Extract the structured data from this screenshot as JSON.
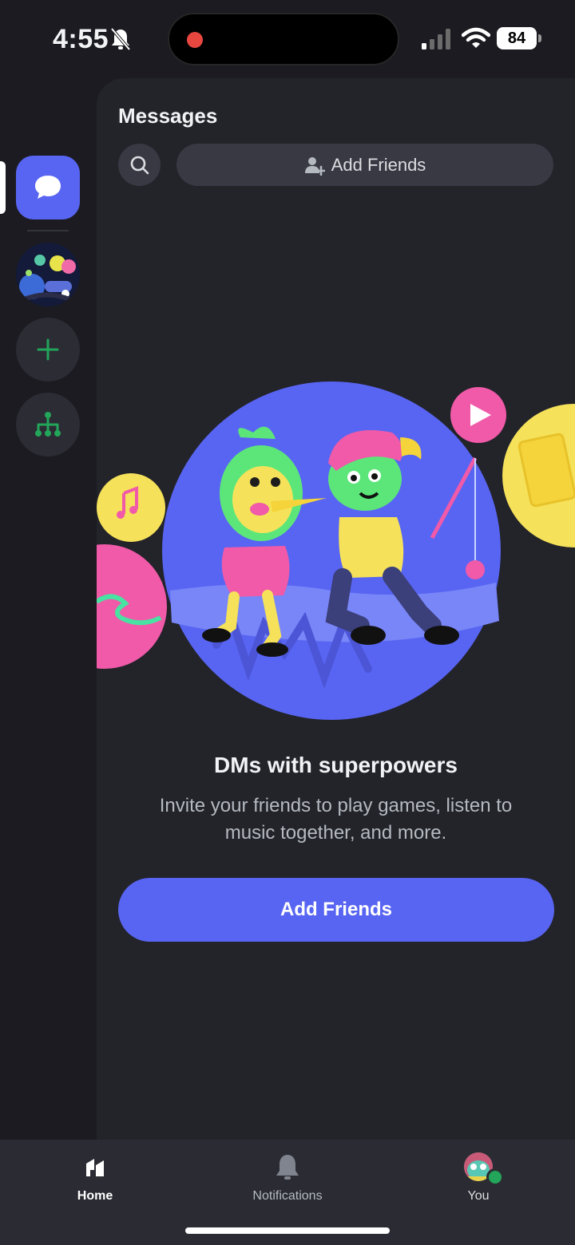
{
  "status_bar": {
    "time": "4:55",
    "battery": "84",
    "icons": [
      "bell-muted-icon",
      "recording-dot-icon",
      "cellular-signal-icon",
      "wifi-icon",
      "battery-icon"
    ]
  },
  "rail": {
    "items": [
      {
        "name": "direct-messages",
        "icon": "chat-bubble-icon",
        "active": true
      },
      {
        "name": "server",
        "icon": "server-avatar"
      },
      {
        "name": "add-server",
        "icon": "plus-icon"
      },
      {
        "name": "discover",
        "icon": "hub-icon"
      }
    ]
  },
  "messages": {
    "title": "Messages",
    "add_friends_top_label": "Add Friends",
    "empty_state": {
      "heading": "DMs with superpowers",
      "subtext": "Invite your friends to play games, listen to music together, and more.",
      "cta_label": "Add Friends"
    }
  },
  "tabs": [
    {
      "label": "Home",
      "icon": "home-icon",
      "active": true
    },
    {
      "label": "Notifications",
      "icon": "bell-icon"
    },
    {
      "label": "You",
      "icon": "avatar"
    }
  ],
  "colors": {
    "accent": "#5865f2",
    "background": "#1b1b21",
    "panel": "#23232a",
    "tabbar": "#2b2c33",
    "online": "#23a55a",
    "add_icon": "#23a55a"
  }
}
